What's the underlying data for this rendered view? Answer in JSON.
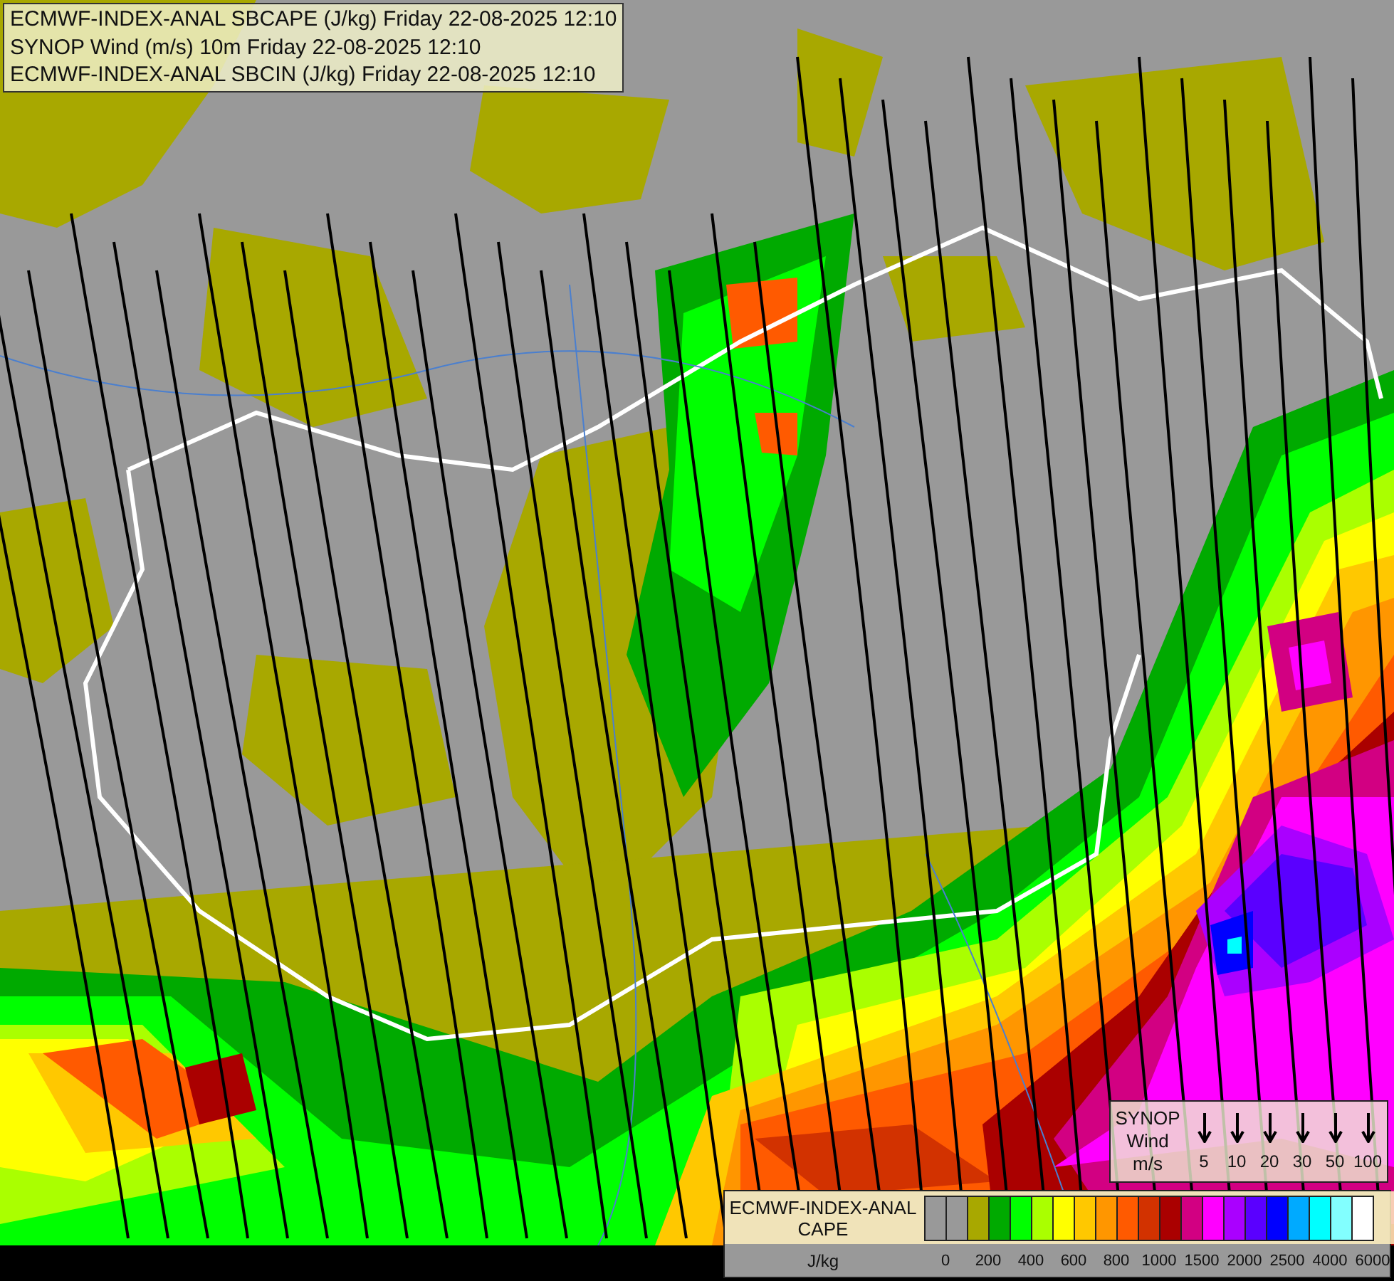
{
  "title_box": {
    "lines": [
      "ECMWF-INDEX-ANAL SBCAPE (J/kg) Friday 22-08-2025 12:10",
      "SYNOP Wind (m/s) 10m Friday 22-08-2025 12:10",
      "ECMWF-INDEX-ANAL SBCIN (J/kg) Friday 22-08-2025 12:10"
    ]
  },
  "wind_legend": {
    "title_lines": [
      "SYNOP",
      "Wind",
      "m/s"
    ],
    "speeds": [
      "5",
      "10",
      "20",
      "30",
      "50",
      "100"
    ]
  },
  "cape_legend": {
    "title_lines": [
      "ECMWF-INDEX-ANAL",
      "CAPE"
    ],
    "unit": "J/kg",
    "swatches": [
      {
        "color": "#999999"
      },
      {
        "color": "#999999"
      },
      {
        "color": "#a8a800"
      },
      {
        "color": "#00aa00"
      },
      {
        "color": "#00ff00"
      },
      {
        "color": "#aaff00"
      },
      {
        "color": "#ffff00"
      },
      {
        "color": "#ffc800"
      },
      {
        "color": "#ff9600"
      },
      {
        "color": "#ff5a00"
      },
      {
        "color": "#d23200"
      },
      {
        "color": "#aa0000"
      },
      {
        "color": "#d20082"
      },
      {
        "color": "#ff00ff"
      },
      {
        "color": "#aa00ff"
      },
      {
        "color": "#5a00ff"
      },
      {
        "color": "#0000ff"
      },
      {
        "color": "#00aaff"
      },
      {
        "color": "#00ffff"
      },
      {
        "color": "#82ffff"
      },
      {
        "color": "#ffffff"
      }
    ],
    "ticks": [
      "0",
      "200",
      "400",
      "600",
      "800",
      "1000",
      "1500",
      "2000",
      "2500",
      "4000",
      "6000"
    ]
  }
}
